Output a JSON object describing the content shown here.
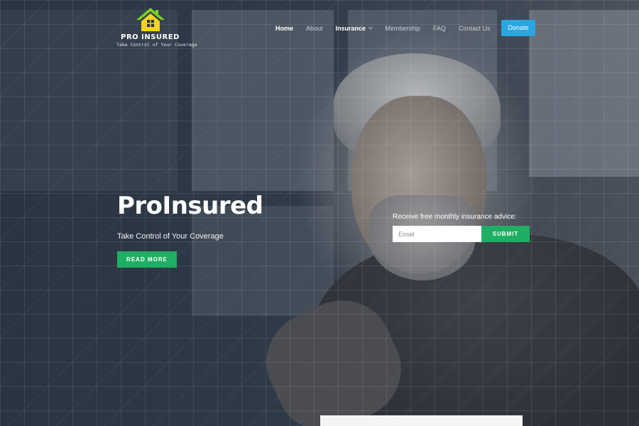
{
  "brand": {
    "name": "PRO INSURED",
    "tagline": "Take Control of Your Coverage",
    "logo_icon": "house-icon",
    "colors": {
      "roof": "#7ad31f",
      "house": "#f2d41a"
    }
  },
  "nav": {
    "items": [
      {
        "label": "Home",
        "active": true
      },
      {
        "label": "About"
      },
      {
        "label": "Insurance",
        "has_dropdown": true
      },
      {
        "label": "Membership"
      },
      {
        "label": "FAQ"
      },
      {
        "label": "Contact Us"
      }
    ],
    "donate_label": "Donate",
    "donate_color": "#2aa6e0"
  },
  "hero": {
    "title": "ProInsured",
    "subtitle": "Take Control of Your Coverage",
    "cta_label": "READ MORE",
    "accent_color": "#1fae63"
  },
  "newsletter": {
    "label": "Receive free monthly insurance advice:",
    "email_placeholder": "Email",
    "submit_label": "SUBMIT"
  }
}
